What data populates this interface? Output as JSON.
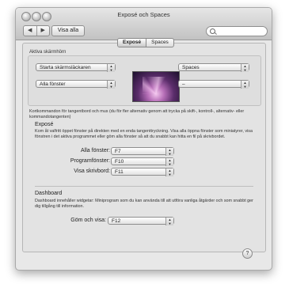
{
  "window": {
    "title": "Exposé och Spaces"
  },
  "toolbar": {
    "back": "◀",
    "forward": "▶",
    "show_all": "Visa alla",
    "search_placeholder": ""
  },
  "tabs": [
    {
      "label": "Exposé",
      "selected": true
    },
    {
      "label": "Spaces",
      "selected": false
    }
  ],
  "active_corners": {
    "heading": "Aktiva skärmhörn",
    "top_left": "Starta skärmsläckaren",
    "top_right": "Spaces",
    "bottom_left": "Alla fönster",
    "bottom_right": "–"
  },
  "shortcuts_intro": "Kortkommandon för tangentbord och mus (du för fler alternativ genom att trycka på skift-, kontroll-, alternativ- eller kommandotangenten)",
  "expose": {
    "heading": "Exposé",
    "description": "Kom åt valfritt öppet fönster på direkten med en enda tangenttryckning. Visa alla öppna fönster som miniatyrer, visa fönstren i det aktiva programmet eller göm alla fönster så att du snabbt kan hitta en fil på skrivbordet.",
    "rows": [
      {
        "label": "Alla fönster:",
        "value": "F7"
      },
      {
        "label": "Programfönster:",
        "value": "F10"
      },
      {
        "label": "Visa skrivbord:",
        "value": "F11"
      }
    ]
  },
  "dashboard": {
    "heading": "Dashboard",
    "description": "Dashboard innehåller widgetar: Miniprogram som du kan använda till att utföra vanliga åtgärder och som snabbt ger dig tillgång till information.",
    "label": "Göm och visa:",
    "value": "F12"
  },
  "help": "?"
}
